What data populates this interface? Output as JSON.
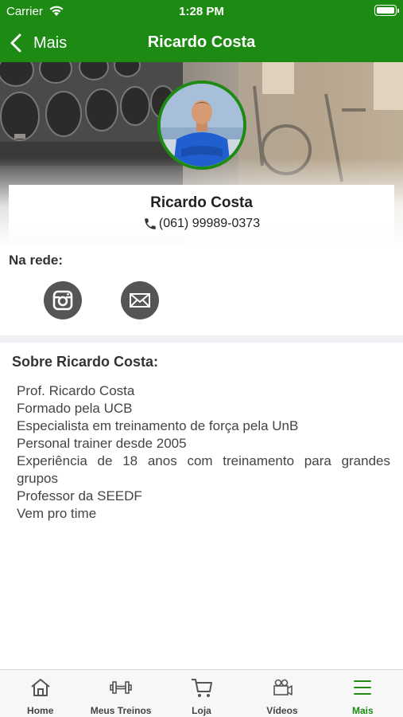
{
  "status_bar": {
    "carrier": "Carrier",
    "time": "1:28 PM"
  },
  "nav": {
    "back_label": "Mais",
    "title": "Ricardo Costa"
  },
  "profile": {
    "name": "Ricardo Costa",
    "phone": "(061) 99989-0373"
  },
  "social": {
    "label": "Na rede:",
    "items": [
      {
        "name": "instagram-icon"
      },
      {
        "name": "email-icon"
      }
    ]
  },
  "about": {
    "title": "Sobre Ricardo Costa:",
    "lines": [
      "Prof. Ricardo Costa",
      "Formado pela UCB",
      "Especialista em treinamento de força pela UnB",
      "Personal trainer desde 2005",
      "Experiência de 18 anos com treinamento para grandes grupos",
      "Professor da SEEDF",
      "Vem pro time"
    ]
  },
  "tabs": [
    {
      "label": "Home",
      "icon": "home-icon"
    },
    {
      "label": "Meus Treinos",
      "icon": "dumbbell-icon"
    },
    {
      "label": "Loja",
      "icon": "cart-icon"
    },
    {
      "label": "Vídeos",
      "icon": "video-camera-icon"
    },
    {
      "label": "Mais",
      "icon": "menu-icon",
      "active": true
    }
  ],
  "colors": {
    "brand_green": "#1d8a14",
    "icon_gray": "#555555"
  }
}
